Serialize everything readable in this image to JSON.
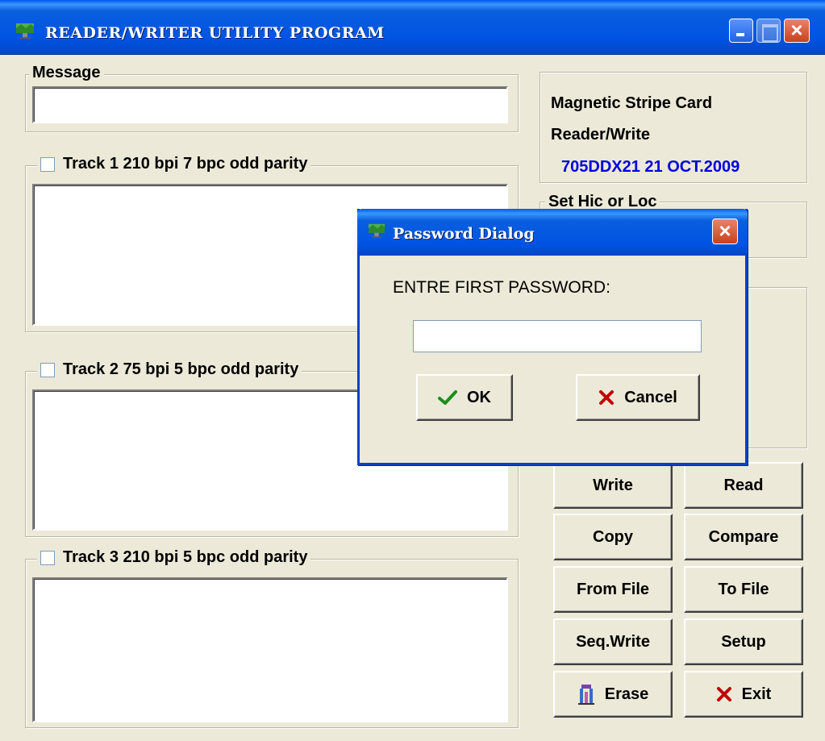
{
  "window": {
    "title": "READER/WRITER UTILITY PROGRAM",
    "controls": {
      "minimize": "minimize-icon",
      "maximize": "maximize-icon",
      "close": "close-icon"
    }
  },
  "message": {
    "label": "Message",
    "value": ""
  },
  "tracks": [
    {
      "label": "Track 1 210 bpi 7 bpc odd parity",
      "checked": false,
      "value": ""
    },
    {
      "label": "Track 2 75  bpi 5 bpc odd parity",
      "checked": false,
      "value": ""
    },
    {
      "label": "Track 3 210 bpi 5 bpc odd parity",
      "checked": false,
      "value": ""
    }
  ],
  "info": {
    "line1": "Magnetic Stripe Card",
    "line2": "Reader/Write",
    "version": "705DDX21 21 OCT.2009"
  },
  "hicloc": {
    "label": "Set Hic or Loc"
  },
  "buttons": {
    "write": "Write",
    "read": "Read",
    "copy": "Copy",
    "compare": "Compare",
    "from_file": "From File",
    "to_file": "To File",
    "seq_write": "Seq.Write",
    "setup": "Setup",
    "erase": "Erase",
    "exit": "Exit"
  },
  "dialog": {
    "title": "Password Dialog",
    "prompt": "ENTRE FIRST PASSWORD:",
    "password_value": "",
    "ok_label": "OK",
    "cancel_label": "Cancel"
  },
  "colors": {
    "titlebar": "#0054e3",
    "face": "#ece9d8",
    "version_text": "#0000e0",
    "ok_check": "#1a8f1a",
    "cancel_x": "#c00000"
  }
}
